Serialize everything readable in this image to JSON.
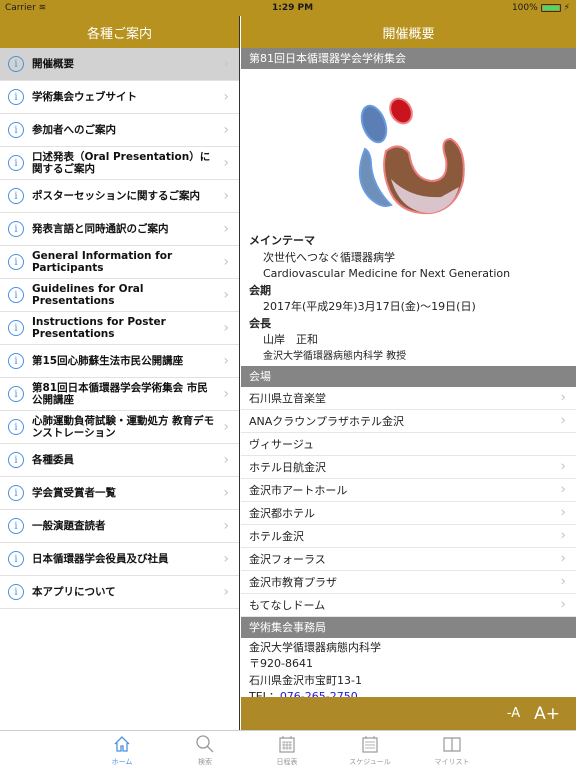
{
  "status_bar": {
    "carrier": "Carrier",
    "time": "1:29 PM",
    "battery": "100%"
  },
  "left_nav": {
    "title": "各種ご案内",
    "items": [
      {
        "label": "開催概要",
        "selected": true
      },
      {
        "label": "学術集会ウェブサイト"
      },
      {
        "label": "参加者へのご案内"
      },
      {
        "label": "口述発表（Oral Presentation）に関するご案内"
      },
      {
        "label": "ポスターセッションに関するご案内"
      },
      {
        "label": "発表言語と同時通訳のご案内"
      },
      {
        "label": "General Information for Participants"
      },
      {
        "label": "Guidelines for Oral Presentations"
      },
      {
        "label": "Instructions for Poster Presentations"
      },
      {
        "label": "第15回心肺蘇生法市民公開講座"
      },
      {
        "label": "第81回日本循環器学会学術集会 市民公開講座"
      },
      {
        "label": "心肺運動負荷試験・運動処方 教育デモンストレーション"
      },
      {
        "label": "各種委員"
      },
      {
        "label": "学会賞受賞者一覧"
      },
      {
        "label": "一般演題査読者"
      },
      {
        "label": "日本循環器学会役員及び社員"
      },
      {
        "label": "本アプリについて"
      }
    ]
  },
  "detail": {
    "title": "開催概要",
    "header": "第81回日本循環器学会学術集会",
    "theme_label": "メインテーマ",
    "theme_ja": "次世代へつなぐ循環器病学",
    "theme_en": "Cardiovascular Medicine for Next Generation",
    "period_label": "会期",
    "period": "2017年(平成29年)3月17日(金)〜19日(日)",
    "president_label": "会長",
    "president_name": "山岸　正和",
    "president_affil": "金沢大学循環器病態内科学 教授",
    "venue_header": "会場",
    "venues": [
      {
        "name": "石川県立音楽堂",
        "link": true
      },
      {
        "name": "ANAクラウンプラザホテル金沢",
        "link": true
      },
      {
        "name": "ヴィサージュ",
        "link": false
      },
      {
        "name": "ホテル日航金沢",
        "link": true
      },
      {
        "name": "金沢市アートホール",
        "link": true
      },
      {
        "name": "金沢都ホテル",
        "link": true
      },
      {
        "name": "ホテル金沢",
        "link": true
      },
      {
        "name": "金沢フォーラス",
        "link": true
      },
      {
        "name": "金沢市教育プラザ",
        "link": true
      },
      {
        "name": "もてなしドーム",
        "link": true
      }
    ],
    "office_header": "学術集会事務局",
    "office_lines": [
      "金沢大学循環器病態内科学",
      "〒920-8641",
      "石川県金沢市宝町13-1"
    ],
    "tel_label": "TEL：",
    "tel": "076-265-2750",
    "font_smaller": "-A",
    "font_larger": "A+"
  },
  "tabs": [
    {
      "label": "ホーム",
      "icon": "home-icon",
      "active": true
    },
    {
      "label": "検索",
      "icon": "search-icon"
    },
    {
      "label": "日程表",
      "icon": "calendar-icon"
    },
    {
      "label": "スケジュール",
      "icon": "schedule-icon"
    },
    {
      "label": "マイリスト",
      "icon": "book-icon"
    }
  ],
  "colors": {
    "brand": "#b8921f",
    "section": "#858585",
    "info_icon": "#4a90e2",
    "link": "#1a1adc"
  }
}
